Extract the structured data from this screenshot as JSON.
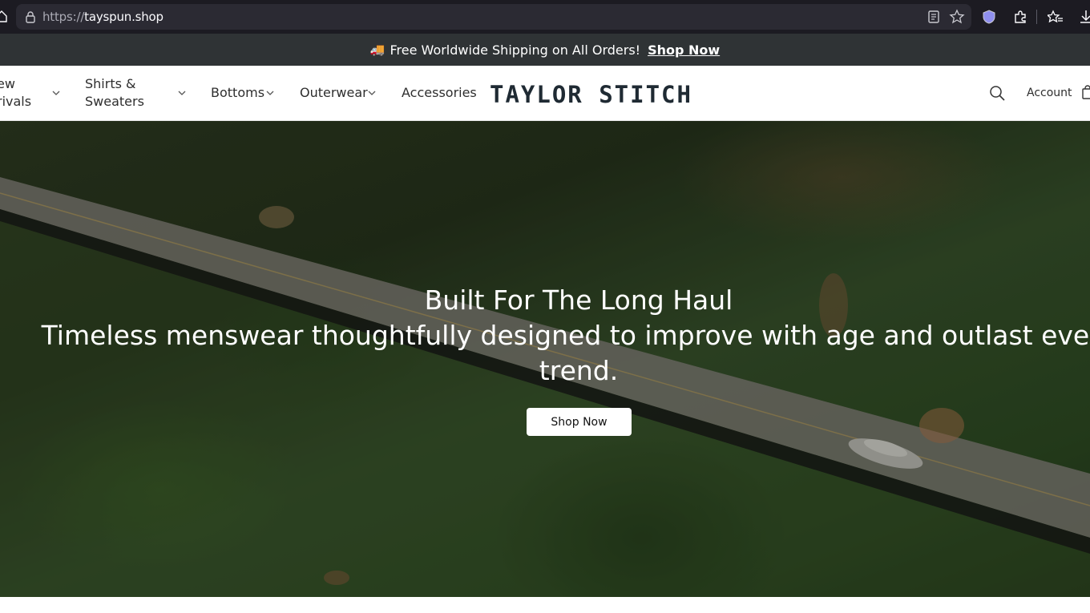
{
  "browser": {
    "url_scheme": "https://",
    "url_host": "tayspun.shop"
  },
  "announcement": {
    "text": "Free Worldwide Shipping on All Orders!",
    "link": "Shop Now",
    "icon": "delivery-truck-emoji"
  },
  "nav": {
    "items": [
      {
        "label_line1": "ew",
        "label_line2": "rivals",
        "has_dropdown": true
      },
      {
        "label_line1": "Shirts &",
        "label_line2": "Sweaters",
        "has_dropdown": true
      },
      {
        "label": "Bottoms",
        "has_dropdown": true
      },
      {
        "label": "Outerwear",
        "has_dropdown": true
      },
      {
        "label": "Accessories",
        "has_dropdown": false
      }
    ],
    "logo": "TAYLOR STITCH",
    "account": "Account"
  },
  "hero": {
    "title": "Built For The Long Haul",
    "subtitle_line1": "Timeless menswear thoughtfully designed to improve with age and outlast every",
    "subtitle_line2": "trend.",
    "button": "Shop Now"
  },
  "colors": {
    "browser_bg": "#1c1b22",
    "url_bg": "#2b2a33",
    "announce_bg": "#2f3335",
    "logo": "#1f2a33"
  }
}
